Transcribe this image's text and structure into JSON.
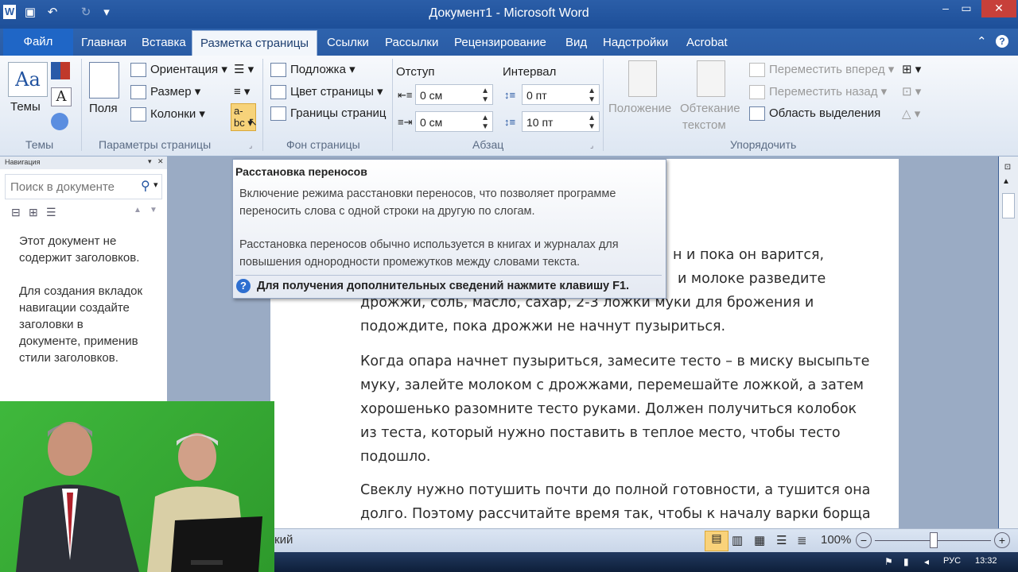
{
  "window": {
    "title": "Документ1 - Microsoft Word"
  },
  "tabs": {
    "file": "Файл",
    "items": [
      "Главная",
      "Вставка",
      "Разметка страницы",
      "Ссылки",
      "Рассылки",
      "Рецензирование",
      "Вид",
      "Надстройки",
      "Acrobat"
    ],
    "active": "Разметка страницы"
  },
  "ribbon": {
    "themes": {
      "label": "Темы",
      "group": "Темы"
    },
    "page_setup": {
      "group": "Параметры страницы",
      "margins": "Поля",
      "orientation": "Ориентация",
      "size": "Размер",
      "columns": "Колонки"
    },
    "page_background": {
      "group": "Фон страницы",
      "watermark": "Подложка",
      "page_color": "Цвет страницы",
      "page_borders": "Границы страниц"
    },
    "paragraph": {
      "group": "Абзац",
      "indent_label": "Отступ",
      "spacing_label": "Интервал",
      "indent_left": "0 см",
      "indent_right": "0 см",
      "spacing_before": "0 пт",
      "spacing_after": "10 пт"
    },
    "arrange": {
      "group": "Упорядочить",
      "position": "Положение",
      "wrap_line1": "Обтекание",
      "wrap_line2": "текстом",
      "bring_forward": "Переместить вперед",
      "send_backward": "Переместить назад",
      "selection_pane": "Область выделения"
    }
  },
  "tooltip": {
    "title": "Расстановка переносов",
    "desc1_line1": "Включение режима расстановки переносов, что позволяет программе",
    "desc1_line2": "переносить слова с одной строки на другую по слогам.",
    "desc2_line1": "Расстановка переносов обычно используется в книгах и журналах для",
    "desc2_line2": "повышения однородности промежутков между словами текста.",
    "help": "Для получения дополнительных сведений нажмите клавишу F1."
  },
  "navpane": {
    "header": "Навигация",
    "search_placeholder": "Поиск в документе",
    "msg1_line1": "Этот документ не",
    "msg1_line2": "содержит заголовков.",
    "msg2_line1": "Для создания вкладок",
    "msg2_line2": "навигации создайте",
    "msg2_line3": "заголовки в",
    "msg2_line4": "документе, применив",
    "msg2_line5": "стили заголовков."
  },
  "document": {
    "lines_partial": [
      "н и пока он варится,",
      "и молоке разведите",
      "дрожжи, соль, масло, сахар, 2-3 ложки муки для брожения и",
      "подождите, пока дрожжи не начнут пузыриться."
    ],
    "para2": [
      "Когда опара начнет пузыриться, замесите тесто – в миску высыпьте",
      "муку, залейте молоком с дрожжами, перемешайте ложкой, а затем",
      "хорошенько разомните тесто руками. Должен получиться колобок",
      "из теста, который нужно поставить в теплое место, чтобы тесто",
      "подошло."
    ],
    "para3": [
      "Свеклу нужно потушить почти до полной готовности, а тушится она",
      "долго. Поэтому рассчитайте время так, чтобы к началу варки борща"
    ]
  },
  "statusbar": {
    "language_partial": "кий",
    "zoom": "100%",
    "zoom_fraction": 0.5
  },
  "taskbar": {
    "lang": "РУС",
    "time": "13:32"
  },
  "colors": {
    "title_bar": "#2b5ea8",
    "file_tab": "#1f66c6",
    "close": "#c7403a",
    "green_screen": "#3fb83c"
  }
}
